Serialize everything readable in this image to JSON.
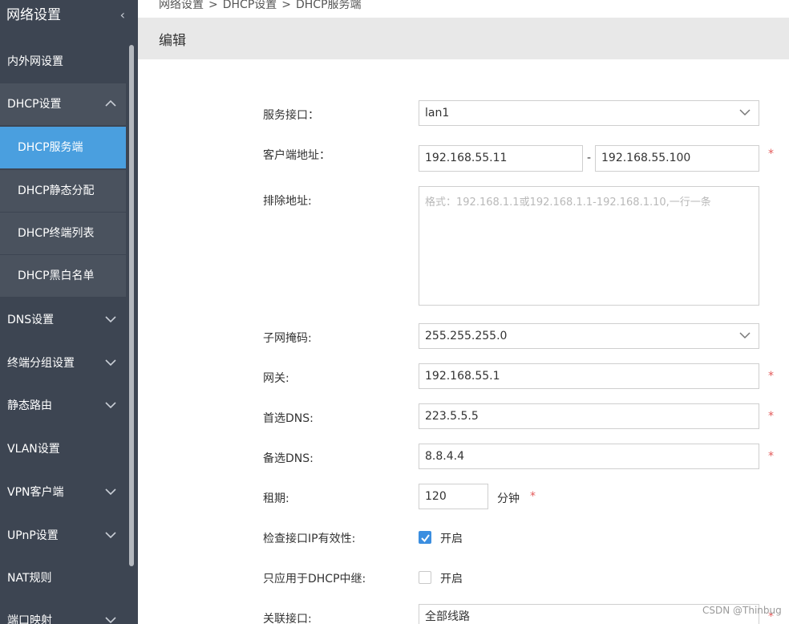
{
  "sidebar": {
    "title": "网络设置",
    "collapse_icon": "‹",
    "items": [
      {
        "label": "内外网设置"
      },
      {
        "label": "DHCP设置"
      },
      {
        "label": "DNS设置"
      },
      {
        "label": "终端分组设置"
      },
      {
        "label": "静态路由"
      },
      {
        "label": "VLAN设置"
      },
      {
        "label": "VPN客户端"
      },
      {
        "label": "UPnP设置"
      },
      {
        "label": "NAT规则"
      },
      {
        "label": "端口映射"
      }
    ],
    "dhcp_sub": [
      {
        "label": "DHCP服务端"
      },
      {
        "label": "DHCP静态分配"
      },
      {
        "label": "DHCP终端列表"
      },
      {
        "label": "DHCP黑白名单"
      }
    ]
  },
  "breadcrumb": [
    "网络设置",
    "DHCP设置",
    "DHCP服务端"
  ],
  "breadcrumb_sep": ">",
  "header": {
    "title": "编辑"
  },
  "form": {
    "service_interface": {
      "label": "服务接口：",
      "value": "lan1"
    },
    "client_address": {
      "label": "客户端地址：",
      "start": "192.168.55.11",
      "sep": "-",
      "end": "192.168.55.100"
    },
    "exclude": {
      "label": "排除地址:",
      "placeholder": "格式：192.168.1.1或192.168.1.1-192.168.1.10,一行一条"
    },
    "subnet": {
      "label": "子网掩码:",
      "value": "255.255.255.0"
    },
    "gateway": {
      "label": "网关:",
      "value": "192.168.55.1"
    },
    "dns1": {
      "label": "首选DNS:",
      "value": "223.5.5.5"
    },
    "dns2": {
      "label": "备选DNS:",
      "value": "8.8.4.4"
    },
    "lease": {
      "label": "租期:",
      "value": "120",
      "unit": "分钟"
    },
    "check_ip": {
      "label": "检查接口IP有效性:",
      "text": "开启",
      "checked": true
    },
    "relay_only": {
      "label": "只应用于DHCP中继:",
      "text": "开启",
      "checked": false
    },
    "linked_if": {
      "label": "关联接口:",
      "value": "全部线路"
    },
    "required_mark": "*"
  },
  "watermark": "CSDN @Thinbug",
  "colors": {
    "sidebar_bg": "#3d4552",
    "active": "#4a9fdf",
    "required": "#e35a5a",
    "checkbox": "#3b8ee0"
  }
}
